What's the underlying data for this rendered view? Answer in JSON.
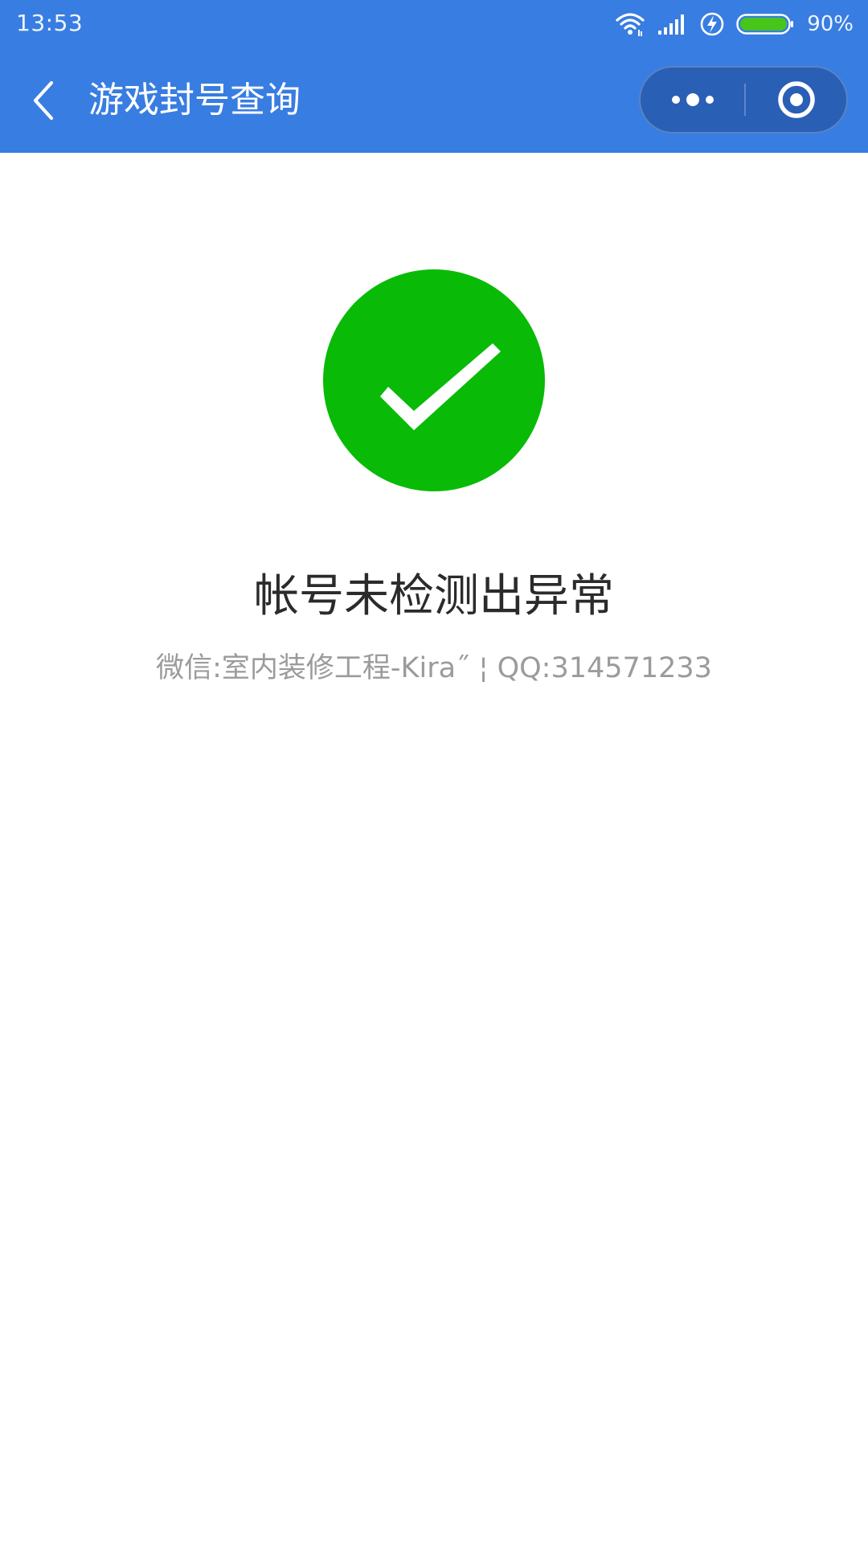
{
  "status_bar": {
    "time": "13:53",
    "battery_percent": "90%",
    "icons": [
      "wifi-icon",
      "signal-icon",
      "charging-icon",
      "battery-icon"
    ]
  },
  "nav": {
    "title": "游戏封号查询",
    "back_icon": "chevron-left-icon",
    "more_icon": "more-dots-icon",
    "close_icon": "target-close-icon"
  },
  "result": {
    "icon": "success-check-icon",
    "title": "帐号未检测出异常",
    "subtitle": "微信:室内装修工程-Kira˝  ¦ QQ:314571233"
  },
  "colors": {
    "header_blue": "#387de1",
    "capsule_blue": "#2a5fb6",
    "success_green": "#09bb07",
    "battery_green": "#47c51a",
    "title_text": "#2b2b2b",
    "subtitle_text": "#9b9b9b"
  }
}
